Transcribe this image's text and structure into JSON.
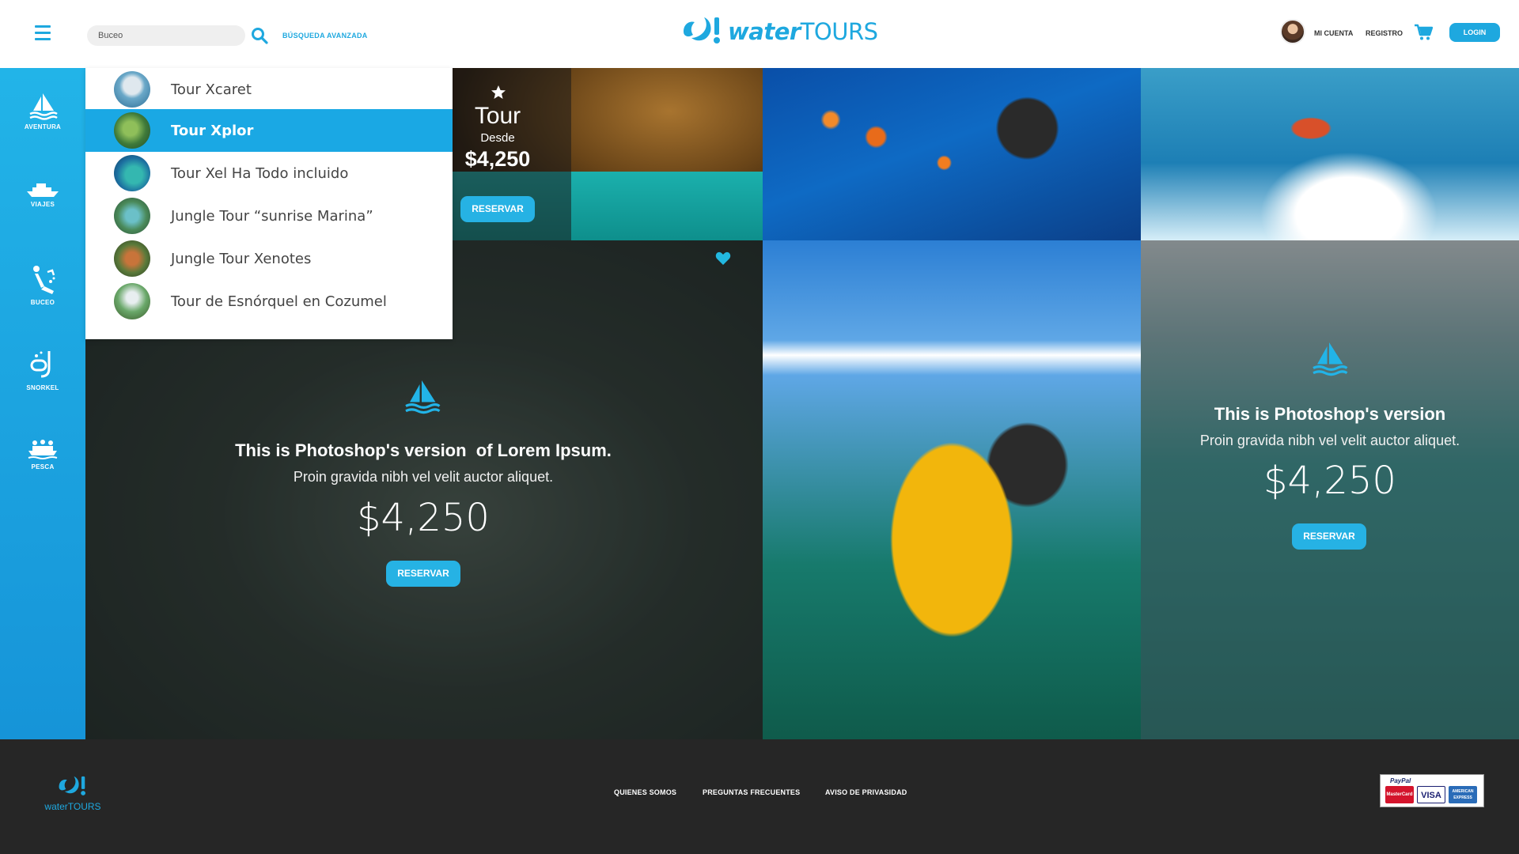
{
  "header": {
    "search_value": "Buceo",
    "advanced_search": "BÚSQUEDA AVANZADA",
    "logo_word_bold": "water",
    "logo_word_light": "TOURS",
    "my_account": "MI CUENTA",
    "register": "REGISTRO",
    "login": "LOGIN",
    "brand_color": "#1ea8df"
  },
  "sidebar": {
    "items": [
      {
        "label": "AVENTURA",
        "icon": "sailboat-icon"
      },
      {
        "label": "VIAJES",
        "icon": "ship-icon"
      },
      {
        "label": "BUCEO",
        "icon": "diver-icon"
      },
      {
        "label": "SNORKEL",
        "icon": "snorkel-icon"
      },
      {
        "label": "PESCA",
        "icon": "fishing-boat-icon"
      }
    ]
  },
  "dropdown": {
    "items": [
      {
        "label": "Tour Xcaret",
        "active": false
      },
      {
        "label": "Tour Xplor",
        "active": true
      },
      {
        "label": "Tour Xel Ha Todo incluido",
        "active": false
      },
      {
        "label": "Jungle Tour “sunrise Marina”",
        "active": false
      },
      {
        "label": "Jungle Tour Xenotes",
        "active": false
      },
      {
        "label": "Tour de Esnórquel en Cozumel",
        "active": false
      }
    ]
  },
  "featured_tour": {
    "title": "Tour",
    "from_label": "Desde",
    "price": "$4,250",
    "cta": "RESERVAR"
  },
  "promo_boat": {
    "title": "This is Photoshop's version  of Lorem Ipsum.",
    "subtitle": "Proin gravida nibh vel velit auctor aliquet.",
    "price": "$4,250",
    "cta": "RESERVAR"
  },
  "promo_beach": {
    "title": "This is Photoshop's version",
    "subtitle": "Proin gravida nibh vel velit auctor aliquet.",
    "price": "$4,250",
    "cta": "RESERVAR"
  },
  "footer": {
    "logo_word": "waterTOURS",
    "links": [
      "QUIENES SOMOS",
      "PREGUNTAS FRECUENTES",
      "AVISO DE PRIVASIDAD"
    ],
    "payments": {
      "paypal": "PayPal",
      "cards": [
        "MasterCard",
        "VISA",
        "AMERICAN EXPRESS"
      ]
    }
  }
}
